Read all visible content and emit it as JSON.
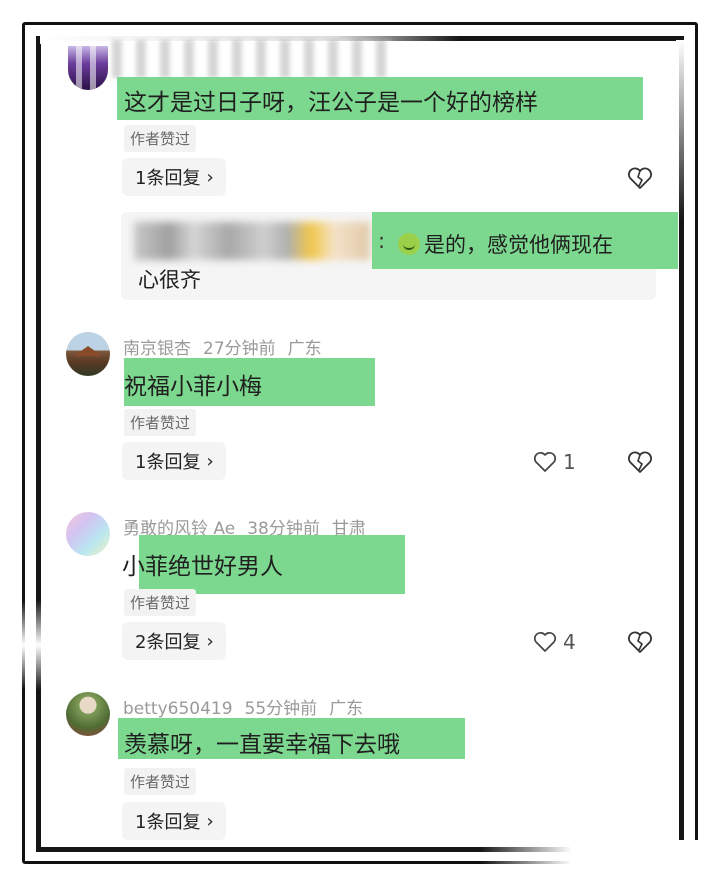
{
  "comments": [
    {
      "text": "这才是过日子呀，汪公子是一个好的榜样",
      "badge": "作者赞过",
      "reply_label": "1条回复",
      "sub_reply": {
        "text_line1": "是的，感觉他俩现在",
        "text_line2": "心很齐"
      }
    },
    {
      "username": "南京银杏",
      "time": "27分钟前",
      "location": "广东",
      "text": "祝福小菲小梅",
      "badge": "作者赞过",
      "reply_label": "1条回复",
      "likes": "1"
    },
    {
      "username": "勇敢的风铃 Ae",
      "time": "38分钟前",
      "location": "甘肃",
      "text": "小菲绝世好男人",
      "badge": "作者赞过",
      "reply_label": "2条回复",
      "likes": "4"
    },
    {
      "username": "betty650419",
      "time": "55分钟前",
      "location": "广东",
      "text": "羡慕呀，一直要幸福下去哦",
      "badge": "作者赞过",
      "reply_label": "1条回复"
    }
  ],
  "icons": {
    "chevron": "chevron-right-icon",
    "like": "heart-icon",
    "dislike": "broken-heart-icon",
    "emoji": "grin-emoji-icon"
  },
  "colors": {
    "highlight": "#7dd88f",
    "badge_bg": "#f2f2f2",
    "meta_text": "#9a9a9a"
  }
}
